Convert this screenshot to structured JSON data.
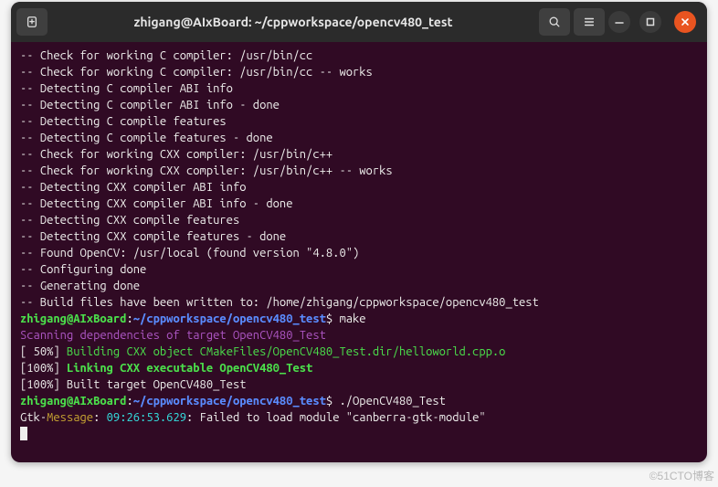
{
  "titlebar": {
    "title": "zhigang@AIxBoard: ~/cppworkspace/opencv480_test"
  },
  "watermark": "©51CTO博客",
  "term": {
    "l01": "-- Check for working C compiler: /usr/bin/cc",
    "l02": "-- Check for working C compiler: /usr/bin/cc -- works",
    "l03": "-- Detecting C compiler ABI info",
    "l04": "-- Detecting C compiler ABI info - done",
    "l05": "-- Detecting C compile features",
    "l06": "-- Detecting C compile features - done",
    "l07": "-- Check for working CXX compiler: /usr/bin/c++",
    "l08": "-- Check for working CXX compiler: /usr/bin/c++ -- works",
    "l09": "-- Detecting CXX compiler ABI info",
    "l10": "-- Detecting CXX compiler ABI info - done",
    "l11": "-- Detecting CXX compile features",
    "l12": "-- Detecting CXX compile features - done",
    "l13": "-- Found OpenCV: /usr/local (found version \"4.8.0\")",
    "l14": "-- Configuring done",
    "l15": "-- Generating done",
    "l16": "-- Build files have been written to: /home/zhigang/cppworkspace/opencv480_test",
    "prompt_user": "zhigang@AIxBoard",
    "prompt_colon": ":",
    "prompt_path": "~/cppworkspace/opencv480_test",
    "prompt_dollar": "$ ",
    "cmd_make": "make",
    "scan_line": "Scanning dependencies of target OpenCV480_Test",
    "pct50": "[ 50%] ",
    "build_cxx": "Building CXX object CMakeFiles/OpenCV480_Test.dir/helloworld.cpp.o",
    "pct100a": "[100%] ",
    "link_cxx": "Linking CXX executable OpenCV480_Test",
    "pct100b": "[100%] Built target OpenCV480_Test",
    "cmd_run": "./OpenCV480_Test",
    "gtk_pre": "Gtk-",
    "gtk_msg": "Message",
    "gtk_colon1": ": ",
    "gtk_time": "09:26:53.629",
    "gtk_rest": ": Failed to load module \"canberra-gtk-module\""
  }
}
